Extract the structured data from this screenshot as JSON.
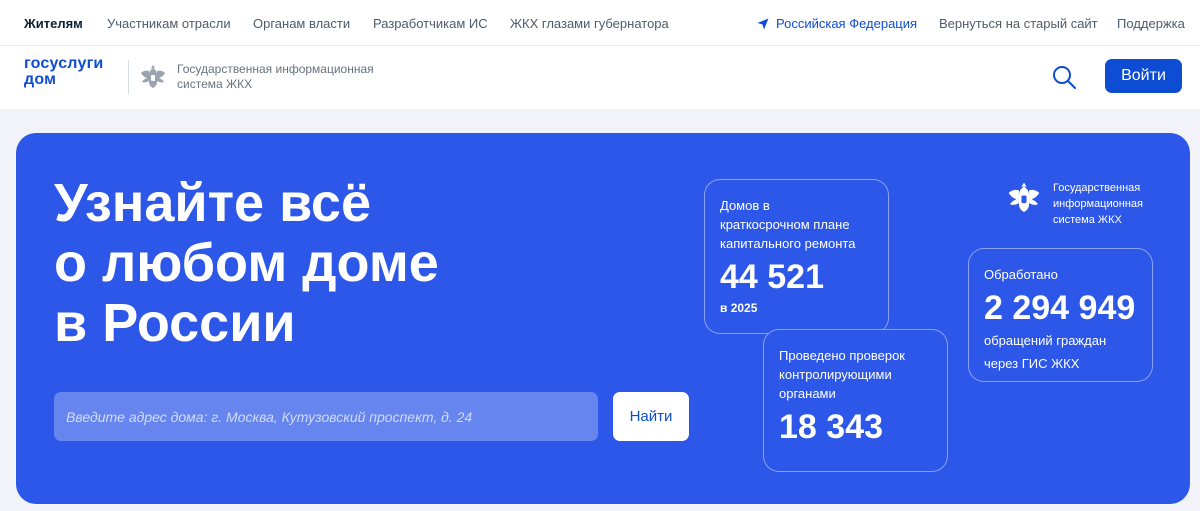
{
  "topnav": {
    "items": [
      "Жителям",
      "Участникам отрасли",
      "Органам власти",
      "Разработчикам ИС",
      "ЖКХ глазами губернатора"
    ],
    "region": "Российская Федерация",
    "old_site": "Вернуться на старый сайт",
    "support": "Поддержка"
  },
  "header": {
    "logo_line1": "госуслуги",
    "logo_line2": "дом",
    "gis_line1": "Государственная информационная",
    "gis_line2": "система ЖКХ",
    "login_label": "Войти"
  },
  "hero": {
    "title_line1": "Узнайте всё",
    "title_line2": "о любом доме",
    "title_line3": "в России",
    "search_placeholder": "Введите адрес дома: г. Москва, Кутузовский проспект, д. 24",
    "find_label": "Найти",
    "gis_line1": "Государственная",
    "gis_line2": "информационная",
    "gis_line3": "система ЖКХ"
  },
  "stats": {
    "houses": {
      "caption_line1": "Домов в",
      "caption_line2": "краткосрочном плане",
      "caption_line3": "капитального ремонта",
      "value": "44 521",
      "sub": "в 2025"
    },
    "inspections": {
      "caption_line1": "Проведено проверок",
      "caption_line2": "контролирующими",
      "caption_line3": "органами",
      "value": "18 343"
    },
    "processed": {
      "caption": "Обработано",
      "value": "2 294 949",
      "sub_line1": "обращений граждан",
      "sub_line2": "через ГИС ЖКХ"
    }
  },
  "colors": {
    "brand": "#0d4cd3",
    "hero_bg": "#2c57e8"
  }
}
